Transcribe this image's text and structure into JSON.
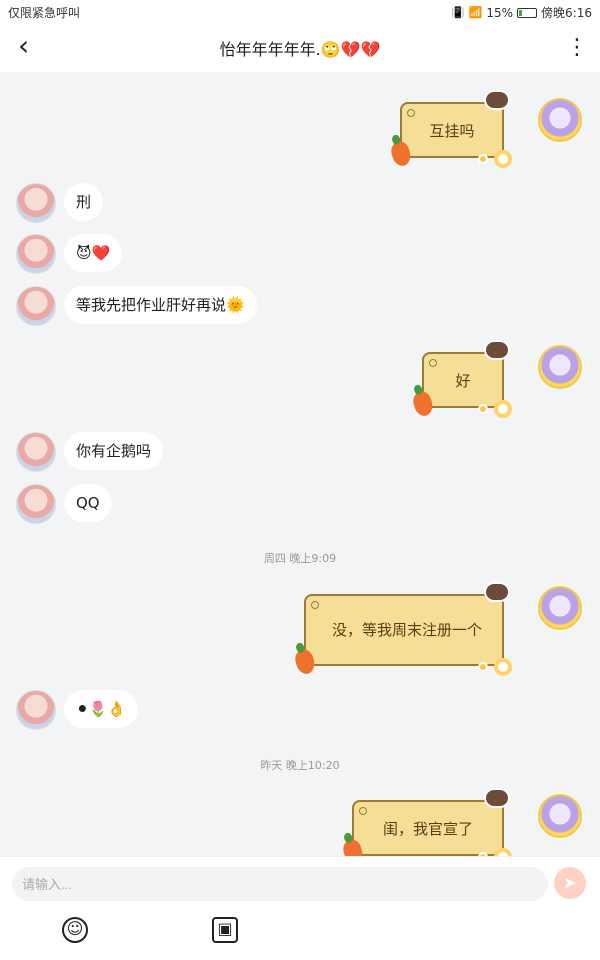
{
  "status": {
    "left": "仅限紧急呼叫",
    "battery": "15%",
    "time": "傍晚6:16"
  },
  "header": {
    "back_icon": "chevron-left-icon",
    "title": "怡年年年年年.🙄💔💔",
    "more_icon": "more-vertical-icon"
  },
  "messages": {
    "m1_out": "互挂吗",
    "m2_in": "刑",
    "m3_in": "😈❤️",
    "m4_in": "等我先把作业肝好再说🌞",
    "m5_out": "好",
    "m6_in": "你有企鹅吗",
    "m7_in": "QQ",
    "t1": "周四 晚上9:09",
    "m8_out": "没，等我周末注册一个",
    "m9_in": "⚫🌷👌",
    "t2": "昨天 晚上10:20",
    "m10_out": "闺，我官宣了"
  },
  "composer": {
    "placeholder": "请输入...",
    "send_icon": "send-icon",
    "emoji_icon": "emoji-icon",
    "image_icon": "image-icon"
  }
}
